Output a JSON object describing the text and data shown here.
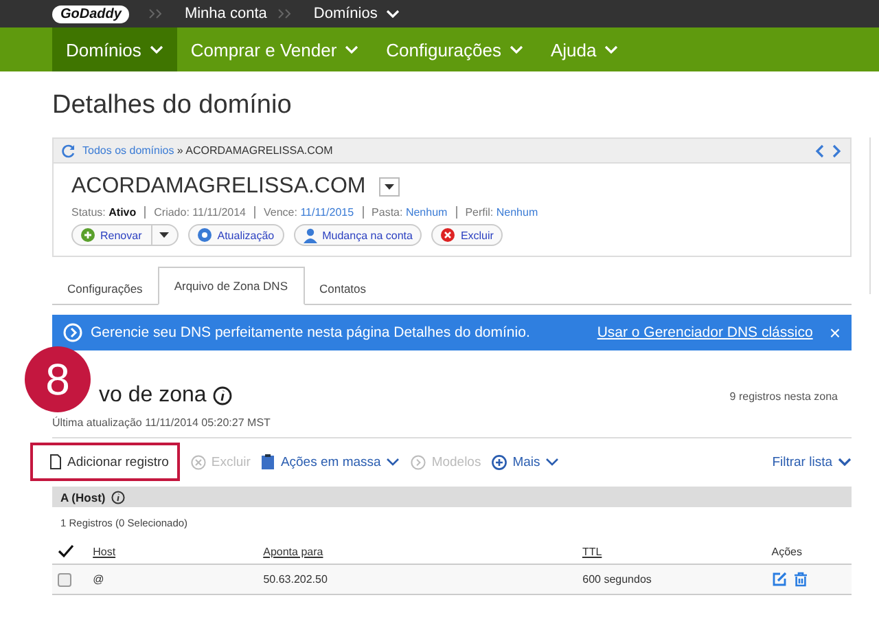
{
  "topbar": {
    "logo": "GoDaddy",
    "crumbs": [
      {
        "label": "Minha conta",
        "dropdown": false
      },
      {
        "label": "Domínios",
        "dropdown": true
      }
    ]
  },
  "nav": [
    {
      "label": "Domínios",
      "selected": true
    },
    {
      "label": "Comprar e Vender",
      "selected": false
    },
    {
      "label": "Configurações",
      "selected": false
    },
    {
      "label": "Ajuda",
      "selected": false
    }
  ],
  "page_title": "Detalhes do domínio",
  "card": {
    "breadcrumb_link": "Todos os domínios",
    "breadcrumb_sep": "»",
    "breadcrumb_current": "ACORDAMAGRELISSA.COM",
    "domain": "ACORDAMAGRELISSA.COM",
    "meta": [
      {
        "label": "Status:",
        "value": "Ativo",
        "kind": "bold"
      },
      {
        "label": "Criado:",
        "value": "11/11/2014",
        "kind": "plain"
      },
      {
        "label": "Vence:",
        "value": "11/11/2015",
        "kind": "link"
      },
      {
        "label": "Pasta:",
        "value": "Nenhum",
        "kind": "link"
      },
      {
        "label": "Perfil:",
        "value": "Nenhum",
        "kind": "link"
      }
    ],
    "buttons": [
      {
        "label": "Renovar",
        "split": true
      },
      {
        "label": "Atualização",
        "split": false
      },
      {
        "label": "Mudança na conta",
        "split": false
      },
      {
        "label": "Excluir",
        "split": false
      }
    ]
  },
  "tabs": [
    {
      "label": "Configurações",
      "selected": false
    },
    {
      "label": "Arquivo de Zona DNS",
      "selected": true
    },
    {
      "label": "Contatos",
      "selected": false
    }
  ],
  "banner": {
    "text": "Gerencie seu DNS perfeitamente nesta página Detalhes do domínio.",
    "link": "Usar o Gerenciador DNS clássico",
    "close": "×"
  },
  "zone": {
    "title": "vo de zona",
    "count": "9 registros nesta zona",
    "updated": "Última atualização 11/11/2014 05:20:27 MST"
  },
  "annotation": {
    "step": "8"
  },
  "toolbar": [
    {
      "label": "Adicionar registro",
      "disabled": false,
      "caret": false,
      "highlighted": true
    },
    {
      "label": "Excluir",
      "disabled": true,
      "caret": false,
      "highlighted": false
    },
    {
      "label": "Ações em massa",
      "disabled": false,
      "caret": true,
      "highlighted": false
    },
    {
      "label": "Modelos",
      "disabled": true,
      "caret": false,
      "highlighted": false
    },
    {
      "label": "Mais",
      "disabled": false,
      "caret": true,
      "highlighted": false
    }
  ],
  "filter": "Filtrar lista",
  "group": {
    "title": "A (Host)",
    "summary": "1 Registros (0 Selecionado)",
    "columns": [
      "Host",
      "Aponta para",
      "TTL",
      "Ações"
    ],
    "rows": [
      {
        "host": "@",
        "points_to": "50.63.202.50",
        "ttl": "600 segundos",
        "checked": false
      }
    ]
  }
}
